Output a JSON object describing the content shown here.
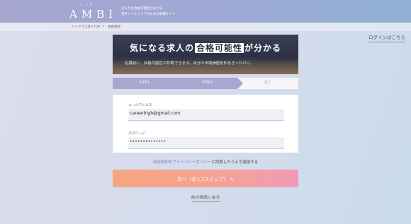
{
  "header": {
    "logo_ruby": "アンビ",
    "logo_text": "AMBI",
    "tagline_line1": "あなたの合格可能性が分かる",
    "tagline_line2": "若手ハイキャリアのための転職サイト"
  },
  "breadcrumb": {
    "home": "ハイクラス求人TOP",
    "separator": ">",
    "current": "会員登録"
  },
  "login_link": "ログインはこちら",
  "banner": {
    "title_before": "気になる求人の",
    "title_highlight": "合格可能性",
    "title_after": "が分かる",
    "subtitle": "応募前に、合格可能性が診断できます。自分の市場価値を知るきっかけに。"
  },
  "steps": [
    {
      "label": "STEP1"
    },
    {
      "label": "STEP2"
    },
    {
      "label": "完了"
    }
  ],
  "form": {
    "email_label": "メールアドレス",
    "email_value": "careerhigh@gmail.com",
    "password_label": "パスワード",
    "password_value": "••••••••••••••"
  },
  "agreement": {
    "terms_link": "利用規約",
    "and": "と",
    "privacy_link": "プライバシーポリシー",
    "rest": "に同意したうえで送信する"
  },
  "submit_label": "次へ（あと1ステップ）  >",
  "back_label": "前の画面に戻る",
  "colors": {
    "accent": "#aaa6cf",
    "submit_start": "#f6a581",
    "submit_end": "#f29bb5",
    "link": "#7a85c8"
  }
}
